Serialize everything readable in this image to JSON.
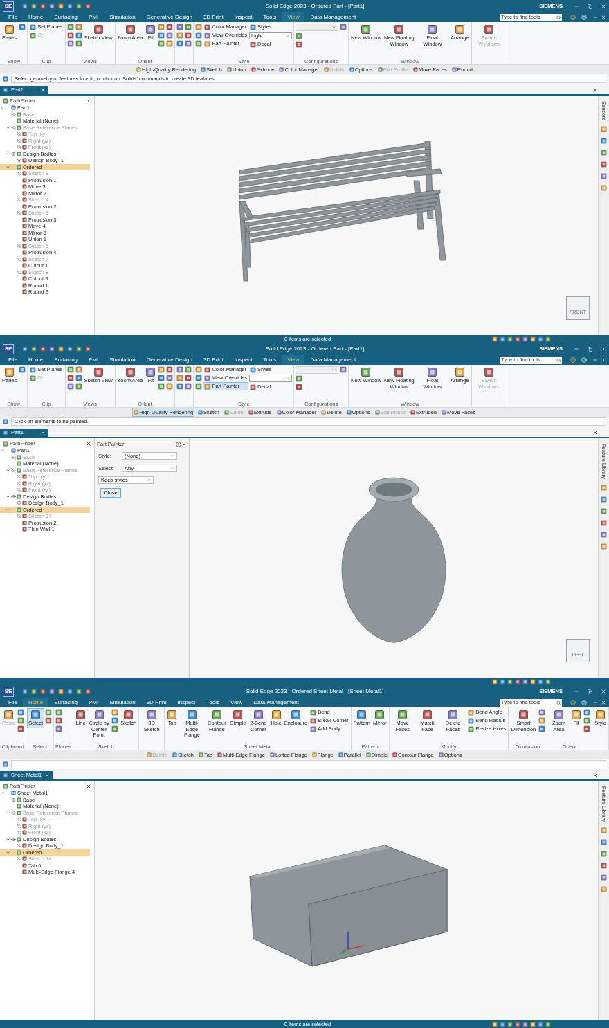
{
  "windows": [
    {
      "logo": "SE",
      "title": "Solid Edge 2023 - Ordered Part - [Part1]",
      "brand": "SIEMENS",
      "search": {
        "placeholder": "Type to find tools"
      },
      "menu": [
        {
          "label": "File",
          "selected": false
        },
        {
          "label": "Home",
          "selected": false
        },
        {
          "label": "Surfacing",
          "selected": false
        },
        {
          "label": "PMI",
          "selected": false
        },
        {
          "label": "Simulation",
          "selected": false
        },
        {
          "label": "Generative Design",
          "selected": false
        },
        {
          "label": "3D Print",
          "selected": false
        },
        {
          "label": "Inspect",
          "selected": false
        },
        {
          "label": "Tools",
          "selected": false
        },
        {
          "label": "View",
          "selected": true
        },
        {
          "label": "Data Management",
          "selected": false
        }
      ],
      "ribbon": [
        {
          "label": "Show",
          "items": [
            {
              "kind": "large",
              "label": "Panes",
              "disabled": false,
              "selected": false
            },
            {
              "kind": "icon"
            }
          ]
        },
        {
          "label": "Clip",
          "items": [
            {
              "kind": "small",
              "label": "Set Planes",
              "disabled": false,
              "selected": false
            },
            {
              "kind": "small",
              "label": "On",
              "disabled": true,
              "selected": false
            }
          ]
        },
        {
          "label": "Views",
          "items": [
            {
              "kind": "icon"
            },
            {
              "kind": "icon"
            },
            {
              "kind": "icon"
            },
            {
              "kind": "icon"
            },
            {
              "kind": "icon"
            },
            {
              "kind": "icon"
            },
            {
              "kind": "large",
              "label": "Sketch View",
              "disabled": false,
              "selected": false
            }
          ]
        },
        {
          "label": "Orient",
          "items": [
            {
              "kind": "large",
              "label": "Zoom Area",
              "disabled": false,
              "selected": false
            },
            {
              "kind": "large",
              "label": "Fit",
              "disabled": false,
              "selected": false
            },
            {
              "kind": "icon"
            },
            {
              "kind": "icon"
            },
            {
              "kind": "icon"
            },
            {
              "kind": "icon"
            },
            {
              "kind": "icon"
            },
            {
              "kind": "icon"
            }
          ]
        },
        {
          "items": [
            {
              "kind": "icon"
            },
            {
              "kind": "icon"
            },
            {
              "kind": "icon"
            },
            {
              "kind": "icon"
            },
            {
              "kind": "icon"
            },
            {
              "kind": "icon"
            }
          ]
        },
        {
          "label": "Style",
          "items": [
            {
              "kind": "icon"
            },
            {
              "kind": "icon"
            },
            {
              "kind": "icon"
            },
            {
              "kind": "small",
              "label": "Color Manager",
              "disabled": false,
              "selected": false
            },
            {
              "kind": "small",
              "label": "View Overrides",
              "disabled": false,
              "selected": false
            },
            {
              "kind": "small",
              "label": "Part Painter",
              "disabled": false,
              "selected": false
            },
            {
              "kind": "small",
              "label": "Styles",
              "disabled": false,
              "selected": false
            },
            {
              "kind": "dropdown",
              "value": "Light",
              "disabled": false
            },
            {
              "kind": "small",
              "label": "Decal",
              "disabled": false,
              "selected": false
            }
          ]
        },
        {
          "label": "Configurations",
          "items": [
            {
              "kind": "dropdown",
              "disabled": true
            },
            {
              "kind": "icon"
            },
            {
              "kind": "icon"
            },
            {
              "kind": "icon"
            }
          ]
        },
        {
          "label": "Window",
          "items": [
            {
              "kind": "large",
              "label": "New Window",
              "disabled": false,
              "selected": false
            },
            {
              "kind": "large",
              "label": "New Floating Window",
              "disabled": false,
              "selected": false
            },
            {
              "kind": "large",
              "label": "Float Window",
              "disabled": false,
              "selected": false
            },
            {
              "kind": "large",
              "label": "Arrange",
              "disabled": false,
              "selected": false
            }
          ]
        },
        {
          "items": [
            {
              "kind": "large",
              "label": "Switch Windows",
              "disabled": true,
              "selected": false
            }
          ]
        }
      ],
      "commands": [
        {
          "label": "High-Quality Rendering",
          "disabled": false,
          "selected": false
        },
        {
          "label": "Sketch",
          "disabled": false,
          "selected": false
        },
        {
          "label": "Union",
          "disabled": false,
          "selected": false
        },
        {
          "label": "Extrude",
          "disabled": false,
          "selected": false
        },
        {
          "label": "Color Manager",
          "disabled": false,
          "selected": false
        },
        {
          "label": "Delete",
          "disabled": true,
          "selected": false
        },
        {
          "label": "Options",
          "disabled": false,
          "selected": false
        },
        {
          "label": "Edit Profile",
          "disabled": true,
          "selected": false
        },
        {
          "label": "Move Faces",
          "disabled": false,
          "selected": false
        },
        {
          "label": "Round",
          "disabled": false,
          "selected": false
        }
      ],
      "prompt": "Select geometry or features to edit, or click on 'Solids' commands to create 3D features.",
      "document_tab": "Part1",
      "pathfinder": {
        "title": "PathFinder",
        "tree": [
          {
            "label": "Part1",
            "selected": false,
            "dimmed": false,
            "expanded": true,
            "children": [
              {
                "label": "Base",
                "selected": false,
                "dimmed": true,
                "visible": false
              },
              {
                "label": "Material (None)",
                "selected": false,
                "dimmed": false
              },
              {
                "label": "Base Reference Planes",
                "selected": false,
                "dimmed": true,
                "visible": false,
                "expanded": true,
                "children": [
                  {
                    "label": "Top (xy)",
                    "selected": false,
                    "dimmed": true,
                    "visible": false
                  },
                  {
                    "label": "Right (yz)",
                    "selected": false,
                    "dimmed": true,
                    "visible": false
                  },
                  {
                    "label": "Front (xz)",
                    "selected": false,
                    "dimmed": true,
                    "visible": false
                  }
                ]
              },
              {
                "label": "Design Bodies",
                "selected": false,
                "dimmed": false,
                "visible": true,
                "expanded": true,
                "children": [
                  {
                    "label": "Design Body_1",
                    "selected": false,
                    "dimmed": false,
                    "visible": true
                  }
                ]
              },
              {
                "label": "Ordered",
                "selected": true,
                "dimmed": false,
                "expanded": true,
                "children": [
                  {
                    "label": "Sketch 3",
                    "selected": false,
                    "dimmed": true,
                    "visible": false
                  },
                  {
                    "label": "Protrusion 1",
                    "selected": false,
                    "dimmed": false
                  },
                  {
                    "label": "Move 3",
                    "selected": false,
                    "dimmed": false
                  },
                  {
                    "label": "Mirror 2",
                    "selected": false,
                    "dimmed": false
                  },
                  {
                    "label": "Sketch 4",
                    "selected": false,
                    "dimmed": true,
                    "visible": false
                  },
                  {
                    "label": "Protrusion 2",
                    "selected": false,
                    "dimmed": false
                  },
                  {
                    "label": "Sketch 5",
                    "selected": false,
                    "dimmed": true,
                    "visible": false
                  },
                  {
                    "label": "Protrusion 3",
                    "selected": false,
                    "dimmed": false
                  },
                  {
                    "label": "Move 4",
                    "selected": false,
                    "dimmed": false
                  },
                  {
                    "label": "Mirror 3",
                    "selected": false,
                    "dimmed": false
                  },
                  {
                    "label": "Union 1",
                    "selected": false,
                    "dimmed": false
                  },
                  {
                    "label": "Sketch 6",
                    "selected": false,
                    "dimmed": true,
                    "visible": false
                  },
                  {
                    "label": "Protrusion 4",
                    "selected": false,
                    "dimmed": false
                  },
                  {
                    "label": "Sketch 7",
                    "selected": false,
                    "dimmed": true,
                    "visible": false
                  },
                  {
                    "label": "Cutout 1",
                    "selected": false,
                    "dimmed": false
                  },
                  {
                    "label": "Sketch 8",
                    "selected": false,
                    "dimmed": true,
                    "visible": false
                  },
                  {
                    "label": "Cutout 3",
                    "selected": false,
                    "dimmed": false
                  },
                  {
                    "label": "Round 1",
                    "selected": false,
                    "dimmed": false
                  },
                  {
                    "label": "Round 2",
                    "selected": false,
                    "dimmed": false
                  }
                ]
              }
            ]
          }
        ]
      },
      "model": {
        "kind": "bench"
      },
      "view_cube": {
        "label": "FRONT"
      },
      "side_panel": "Sensors",
      "status": "0 items are selected"
    },
    {
      "logo": "SE",
      "title": "Solid Edge 2023 - Ordered Part - [Part1]",
      "brand": "SIEMENS",
      "search": {
        "placeholder": "Type to find tools"
      },
      "menu": [
        {
          "label": "File",
          "selected": false
        },
        {
          "label": "Home",
          "selected": false
        },
        {
          "label": "Surfacing",
          "selected": false
        },
        {
          "label": "PMI",
          "selected": false
        },
        {
          "label": "Simulation",
          "selected": false
        },
        {
          "label": "Generative Design",
          "selected": false
        },
        {
          "label": "3D Print",
          "selected": false
        },
        {
          "label": "Inspect",
          "selected": false
        },
        {
          "label": "Tools",
          "selected": false
        },
        {
          "label": "View",
          "selected": true
        },
        {
          "label": "Data Management",
          "selected": false
        }
      ],
      "ribbon": [
        {
          "label": "Show",
          "items": [
            {
              "kind": "large",
              "label": "Panes",
              "disabled": false,
              "selected": false
            },
            {
              "kind": "icon"
            }
          ]
        },
        {
          "label": "Clip",
          "items": [
            {
              "kind": "small",
              "label": "Set Planes",
              "disabled": false,
              "selected": false
            },
            {
              "kind": "small",
              "label": "On",
              "disabled": true,
              "selected": false
            }
          ]
        },
        {
          "label": "Views",
          "items": [
            {
              "kind": "icon"
            },
            {
              "kind": "icon"
            },
            {
              "kind": "icon"
            },
            {
              "kind": "icon"
            },
            {
              "kind": "icon"
            },
            {
              "kind": "icon"
            },
            {
              "kind": "large",
              "label": "Sketch View",
              "disabled": false,
              "selected": false
            }
          ]
        },
        {
          "label": "Orient",
          "items": [
            {
              "kind": "large",
              "label": "Zoom Area",
              "disabled": false,
              "selected": false
            },
            {
              "kind": "large",
              "label": "Fit",
              "disabled": false,
              "selected": false
            },
            {
              "kind": "icon"
            },
            {
              "kind": "icon"
            },
            {
              "kind": "icon"
            },
            {
              "kind": "icon"
            },
            {
              "kind": "icon"
            },
            {
              "kind": "icon"
            }
          ]
        },
        {
          "items": [
            {
              "kind": "icon"
            },
            {
              "kind": "icon"
            },
            {
              "kind": "icon"
            },
            {
              "kind": "icon"
            },
            {
              "kind": "icon"
            },
            {
              "kind": "icon"
            }
          ]
        },
        {
          "label": "Style",
          "items": [
            {
              "kind": "icon"
            },
            {
              "kind": "icon"
            },
            {
              "kind": "icon"
            },
            {
              "kind": "small",
              "label": "Color Manager",
              "disabled": false,
              "selected": false
            },
            {
              "kind": "small",
              "label": "View Overrides",
              "disabled": false,
              "selected": false
            },
            {
              "kind": "small",
              "label": "Part Painter",
              "disabled": false,
              "selected": true
            },
            {
              "kind": "small",
              "label": "Styles",
              "disabled": false,
              "selected": false
            },
            {
              "kind": "dropdown",
              "disabled": false
            },
            {
              "kind": "small",
              "label": "Decal",
              "disabled": false,
              "selected": false
            }
          ]
        },
        {
          "label": "Configurations",
          "items": [
            {
              "kind": "dropdown",
              "disabled": true
            },
            {
              "kind": "icon"
            },
            {
              "kind": "icon"
            },
            {
              "kind": "icon"
            }
          ]
        },
        {
          "label": "Window",
          "items": [
            {
              "kind": "large",
              "label": "New Window",
              "disabled": false,
              "selected": false
            },
            {
              "kind": "large",
              "label": "New Floating Window",
              "disabled": false,
              "selected": false
            },
            {
              "kind": "large",
              "label": "Float Window",
              "disabled": false,
              "selected": false
            },
            {
              "kind": "large",
              "label": "Arrange",
              "disabled": false,
              "selected": false
            }
          ]
        },
        {
          "items": [
            {
              "kind": "large",
              "label": "Switch Windows",
              "disabled": true,
              "selected": false
            }
          ]
        }
      ],
      "commands": [
        {
          "label": "High-Quality Rendering",
          "disabled": false,
          "selected": true
        },
        {
          "label": "Sketch",
          "disabled": false,
          "selected": false
        },
        {
          "label": "Union",
          "disabled": true,
          "selected": false
        },
        {
          "label": "Extrude",
          "disabled": false,
          "selected": false
        },
        {
          "label": "Color Manager",
          "disabled": false,
          "selected": false
        },
        {
          "label": "Delete",
          "disabled": false,
          "selected": false
        },
        {
          "label": "Options",
          "disabled": false,
          "selected": false
        },
        {
          "label": "Edit Profile",
          "disabled": true,
          "selected": false
        },
        {
          "label": "Extruded",
          "disabled": false,
          "selected": false
        },
        {
          "label": "Move Faces",
          "disabled": false,
          "selected": false
        }
      ],
      "prompt": "Click on elements to be painted.",
      "document_tab": "Part1",
      "pathfinder": {
        "title": "PathFinder",
        "tree": [
          {
            "label": "Part1",
            "selected": false,
            "dimmed": false,
            "expanded": true,
            "children": [
              {
                "label": "Base",
                "selected": false,
                "dimmed": true,
                "visible": false
              },
              {
                "label": "Material (None)",
                "selected": false,
                "dimmed": false
              },
              {
                "label": "Base Reference Planes",
                "selected": false,
                "dimmed": true,
                "visible": false,
                "expanded": true,
                "children": [
                  {
                    "label": "Top (xy)",
                    "selected": false,
                    "dimmed": true,
                    "visible": false
                  },
                  {
                    "label": "Right (yz)",
                    "selected": false,
                    "dimmed": true,
                    "visible": false
                  },
                  {
                    "label": "Front (xz)",
                    "selected": false,
                    "dimmed": true,
                    "visible": false
                  }
                ]
              },
              {
                "label": "Design Bodies",
                "selected": false,
                "dimmed": false,
                "visible": true,
                "expanded": true,
                "children": [
                  {
                    "label": "Design Body_1",
                    "selected": false,
                    "dimmed": false,
                    "visible": true
                  }
                ]
              },
              {
                "label": "Ordered",
                "selected": true,
                "dimmed": false,
                "expanded": true,
                "children": [
                  {
                    "label": "Sketch 17",
                    "selected": false,
                    "dimmed": true,
                    "visible": false
                  },
                  {
                    "label": "Protrusion 2",
                    "selected": false,
                    "dimmed": false
                  },
                  {
                    "label": "Thin-Wall 1",
                    "selected": false,
                    "dimmed": false
                  }
                ]
              }
            ]
          }
        ]
      },
      "dialog": {
        "title": "Part Painter",
        "fields": [
          {
            "label": "Style:",
            "value": "(None)"
          },
          {
            "label": "Select:",
            "value": "Any"
          },
          {
            "value": "Keep styles"
          }
        ],
        "button": "Close"
      },
      "model": {
        "kind": "vase"
      },
      "view_cube": {
        "label": "LEFT"
      },
      "side_panel": "Feature Library"
    },
    {
      "logo": "SE",
      "title": "Solid Edge 2023 - Ordered Sheet Metal - [Sheet Metal1]",
      "brand": "SIEMENS",
      "search": {
        "placeholder": "Type to find tools"
      },
      "menu": [
        {
          "label": "File",
          "selected": false
        },
        {
          "label": "Home",
          "selected": true
        },
        {
          "label": "Surfacing",
          "selected": false
        },
        {
          "label": "PMI",
          "selected": false
        },
        {
          "label": "Simulation",
          "selected": false
        },
        {
          "label": "3D Print",
          "selected": false
        },
        {
          "label": "Inspect",
          "selected": false
        },
        {
          "label": "Tools",
          "selected": false
        },
        {
          "label": "View",
          "selected": false
        },
        {
          "label": "Data Management",
          "selected": false
        }
      ],
      "ribbon": [
        {
          "label": "Clipboard",
          "items": [
            {
              "kind": "large",
              "label": "Paste",
              "disabled": true,
              "selected": false
            },
            {
              "kind": "icon"
            },
            {
              "kind": "icon"
            },
            {
              "kind": "icon"
            }
          ]
        },
        {
          "label": "Select",
          "items": [
            {
              "kind": "large",
              "label": "Select",
              "disabled": false,
              "selected": true
            },
            {
              "kind": "icon"
            },
            {
              "kind": "icon"
            }
          ]
        },
        {
          "label": "Planes",
          "items": [
            {
              "kind": "icon"
            },
            {
              "kind": "icon"
            },
            {
              "kind": "icon"
            }
          ]
        },
        {
          "label": "Sketch",
          "items": [
            {
              "kind": "large",
              "label": "Line",
              "disabled": false,
              "selected": false
            },
            {
              "kind": "large",
              "label": "Circle by Center Point",
              "disabled": false,
              "selected": false
            },
            {
              "kind": "icon"
            },
            {
              "kind": "icon"
            },
            {
              "kind": "icon"
            },
            {
              "kind": "large",
              "label": "Sketch",
              "disabled": false,
              "selected": false
            }
          ]
        },
        {
          "items": [
            {
              "kind": "large",
              "label": "3D Sketch",
              "disabled": false,
              "selected": false
            }
          ]
        },
        {
          "label": "Sheet Metal",
          "items": [
            {
              "kind": "large",
              "label": "Tab",
              "disabled": false,
              "selected": false
            },
            {
              "kind": "large",
              "label": "Multi-Edge Flange",
              "disabled": false,
              "selected": false
            },
            {
              "kind": "large",
              "label": "Contour Flange",
              "disabled": false,
              "selected": false
            },
            {
              "kind": "large",
              "label": "Dimple",
              "disabled": false,
              "selected": false
            },
            {
              "kind": "large",
              "label": "2-Bend Corner",
              "disabled": false,
              "selected": false
            },
            {
              "kind": "large",
              "label": "Hole",
              "disabled": false,
              "selected": false
            },
            {
              "kind": "large",
              "label": "Enclosure",
              "disabled": false,
              "selected": false
            },
            {
              "kind": "small",
              "label": "Bend",
              "disabled": false,
              "selected": false
            },
            {
              "kind": "small",
              "label": "Break Corner",
              "disabled": false,
              "selected": false
            },
            {
              "kind": "small",
              "label": "Add Body",
              "disabled": false,
              "selected": false
            }
          ]
        },
        {
          "label": "Pattern",
          "items": [
            {
              "kind": "large",
              "label": "Pattern",
              "disabled": false,
              "selected": false
            },
            {
              "kind": "large",
              "label": "Mirror",
              "disabled": false,
              "selected": false
            }
          ]
        },
        {
          "label": "Modify",
          "items": [
            {
              "kind": "large",
              "label": "Move Faces",
              "disabled": false,
              "selected": false
            },
            {
              "kind": "large",
              "label": "Match Face",
              "disabled": false,
              "selected": false
            },
            {
              "kind": "large",
              "label": "Delete Faces",
              "disabled": false,
              "selected": false
            },
            {
              "kind": "small",
              "label": "Bend Angle",
              "disabled": false,
              "selected": false
            },
            {
              "kind": "small",
              "label": "Bend Radius",
              "disabled": false,
              "selected": false
            },
            {
              "kind": "small",
              "label": "Resize Holes",
              "disabled": false,
              "selected": false
            }
          ]
        },
        {
          "label": "Dimension",
          "items": [
            {
              "kind": "large",
              "label": "Smart Dimension",
              "disabled": false,
              "selected": false
            },
            {
              "kind": "icon"
            },
            {
              "kind": "icon"
            },
            {
              "kind": "icon"
            }
          ]
        },
        {
          "label": "Orient",
          "items": [
            {
              "kind": "large",
              "label": "Zoom Area",
              "disabled": false,
              "selected": false
            },
            {
              "kind": "large",
              "label": "Fit",
              "disabled": false,
              "selected": false
            },
            {
              "kind": "icon"
            },
            {
              "kind": "icon"
            },
            {
              "kind": "icon"
            }
          ]
        },
        {
          "items": [
            {
              "kind": "large",
              "label": "Style",
              "disabled": false,
              "selected": false
            }
          ]
        }
      ],
      "commands": [
        {
          "label": "Delete",
          "disabled": true,
          "selected": false
        },
        {
          "label": "Sketch",
          "disabled": false,
          "selected": false
        },
        {
          "label": "Tab",
          "disabled": false,
          "selected": false
        },
        {
          "label": "Multi-Edge Flange",
          "disabled": false,
          "selected": false
        },
        {
          "label": "Lofted Flange",
          "disabled": false,
          "selected": false
        },
        {
          "label": "Flange",
          "disabled": false,
          "selected": false
        },
        {
          "label": "Parallel",
          "disabled": false,
          "selected": false
        },
        {
          "label": "Dimple",
          "disabled": false,
          "selected": false
        },
        {
          "label": "Contour Flange",
          "disabled": false,
          "selected": false
        },
        {
          "label": "Options",
          "disabled": false,
          "selected": false
        }
      ],
      "document_tab": "Sheet Metal1",
      "pathfinder": {
        "title": "PathFinder",
        "tree": [
          {
            "label": "Sheet Metal1",
            "selected": false,
            "dimmed": false,
            "expanded": true,
            "children": [
              {
                "label": "Base",
                "selected": false,
                "dimmed": false,
                "visible": true
              },
              {
                "label": "Material (None)",
                "selected": false,
                "dimmed": false
              },
              {
                "label": "Base Reference Planes",
                "selected": false,
                "dimmed": true,
                "visible": false,
                "expanded": true,
                "children": [
                  {
                    "label": "Top (xy)",
                    "selected": false,
                    "dimmed": true,
                    "visible": false
                  },
                  {
                    "label": "Right (yz)",
                    "selected": false,
                    "dimmed": true,
                    "visible": false
                  },
                  {
                    "label": "Front (xz)",
                    "selected": false,
                    "dimmed": true,
                    "visible": false
                  }
                ]
              },
              {
                "label": "Design Bodies",
                "selected": false,
                "dimmed": false,
                "visible": true,
                "expanded": true,
                "children": [
                  {
                    "label": "Design Body_1",
                    "selected": false,
                    "dimmed": false,
                    "visible": false
                  }
                ]
              },
              {
                "label": "Ordered",
                "selected": true,
                "dimmed": false,
                "expanded": true,
                "children": [
                  {
                    "label": "Sketch 14",
                    "selected": false,
                    "dimmed": true,
                    "visible": false
                  },
                  {
                    "label": "Tab 6",
                    "selected": false,
                    "dimmed": false
                  },
                  {
                    "label": "Multi-Edge Flange 4",
                    "selected": false,
                    "dimmed": false
                  }
                ]
              }
            ]
          }
        ]
      },
      "model": {
        "kind": "sheet-box"
      },
      "side_panel": "Feature Library",
      "status": "0 items are selected"
    }
  ]
}
